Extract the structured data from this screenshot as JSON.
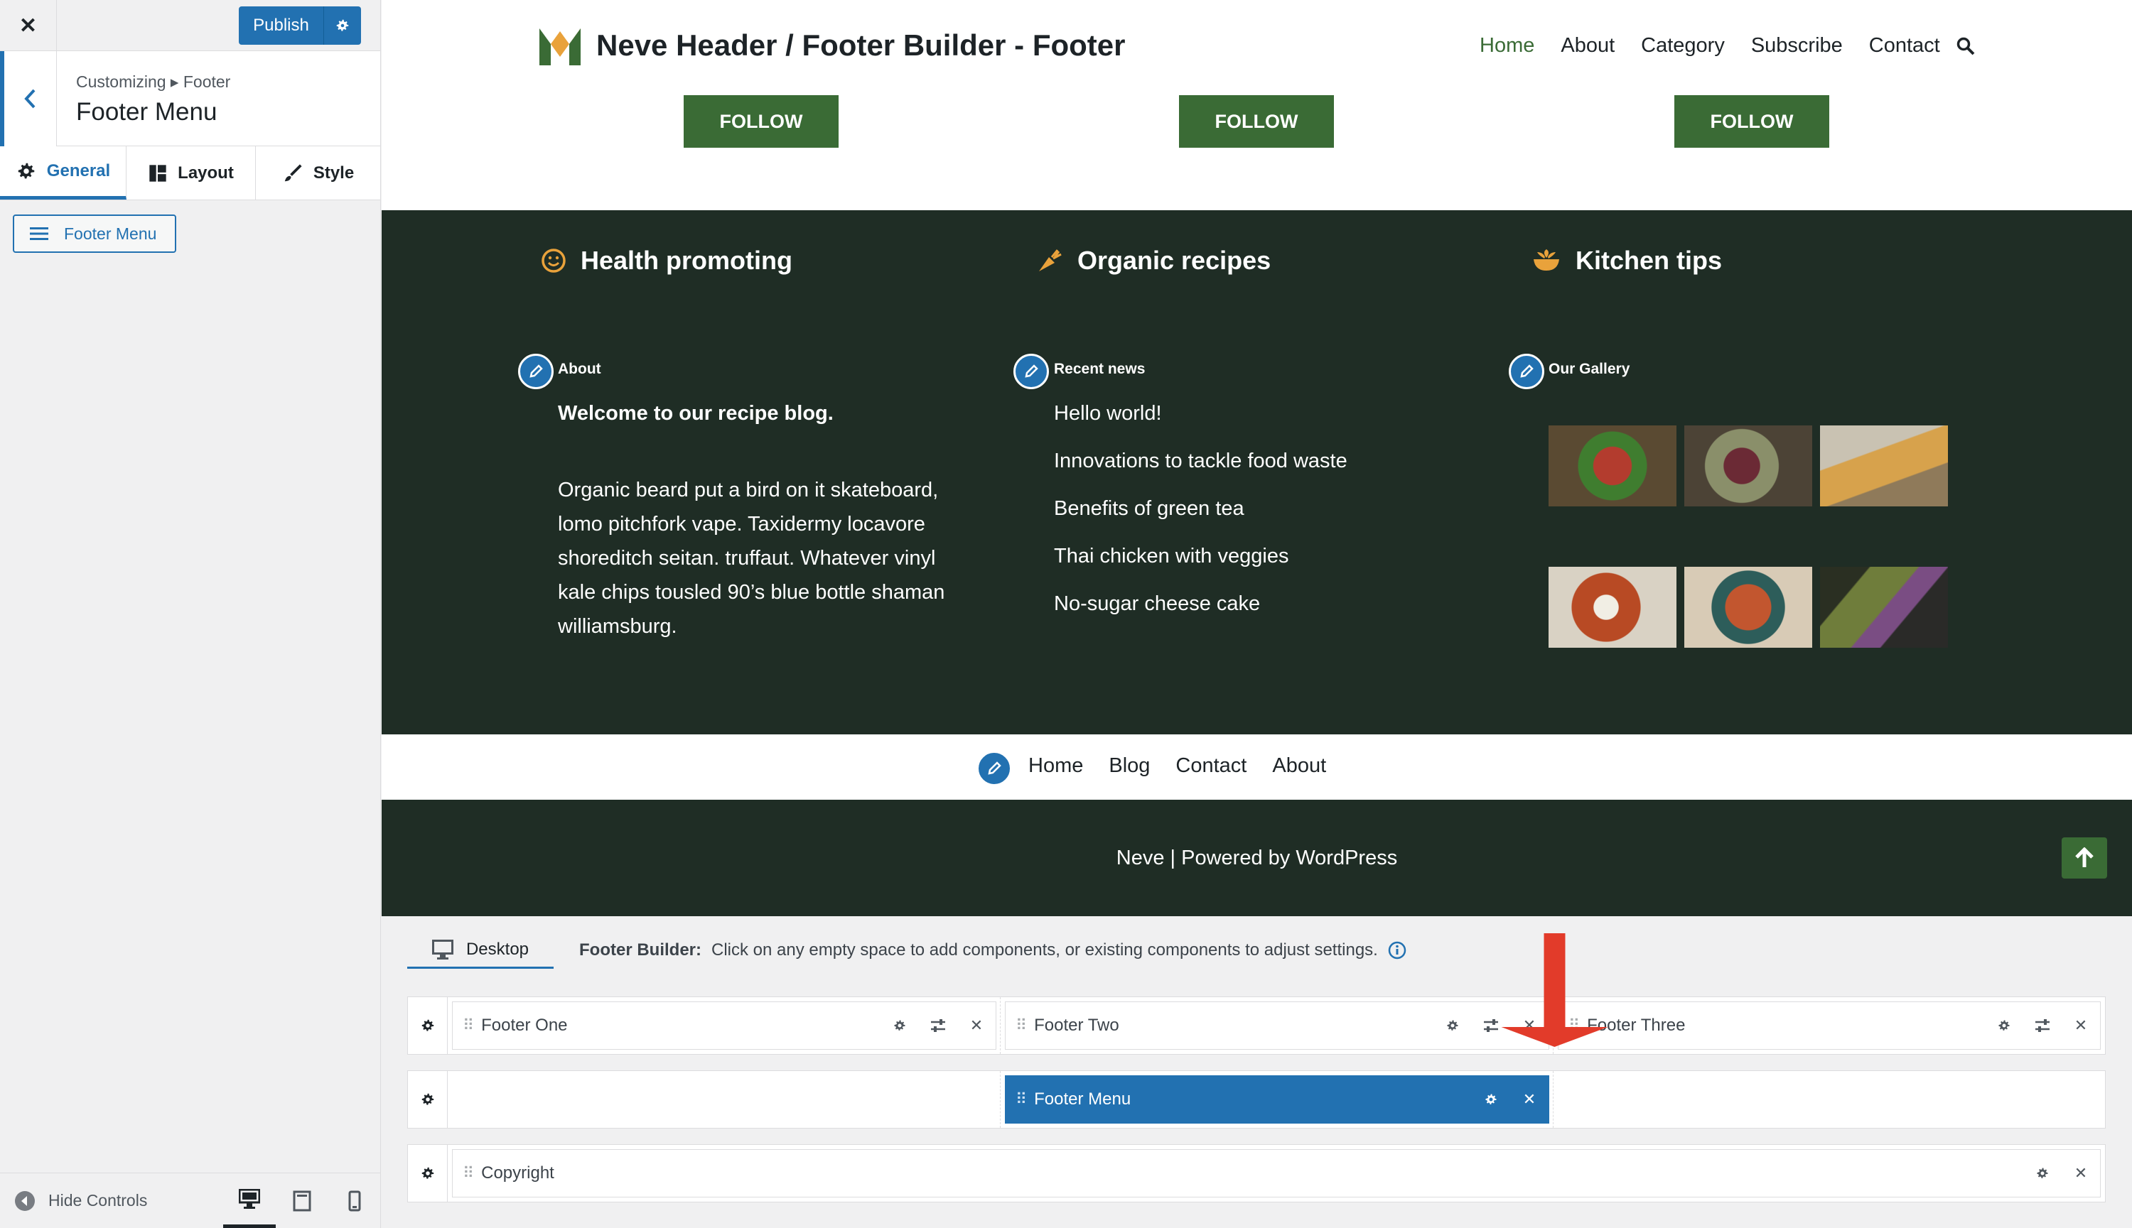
{
  "customizer": {
    "close_glyph": "✕",
    "publish_label": "Publish",
    "breadcrumb": "Customizing ▸ Footer",
    "section_title": "Footer Menu",
    "tabs": [
      {
        "label": "General",
        "icon": "gear-icon",
        "active": true
      },
      {
        "label": "Layout",
        "icon": "layout-icon",
        "active": false
      },
      {
        "label": "Style",
        "icon": "brush-icon",
        "active": false
      }
    ],
    "component_chip": "Footer Menu",
    "hide_controls": "Hide Controls",
    "devices": [
      "desktop-icon",
      "tablet-icon",
      "mobile-icon"
    ]
  },
  "site": {
    "title": "Neve Header / Footer Builder - Footer",
    "nav": [
      "Home",
      "About",
      "Category",
      "Subscribe",
      "Contact"
    ],
    "follow_label": "FOLLOW",
    "features": [
      {
        "label": "Health promoting",
        "icon": "smile-icon"
      },
      {
        "label": "Organic recipes",
        "icon": "carrot-icon"
      },
      {
        "label": "Kitchen tips",
        "icon": "bowl-icon"
      }
    ],
    "widgets": {
      "about_title": "About",
      "about_strong": "Welcome to our recipe blog.",
      "about_body": "Organic beard put a bird on it skateboard, lomo pitchfork vape. Taxidermy locavore shoreditch seitan. truffaut. Whatever vinyl kale chips tousled 90’s blue bottle shaman williamsburg.",
      "news_title": "Recent news",
      "news": [
        "Hello world!",
        "Innovations to tackle food waste",
        "Benefits of green tea",
        "Thai chicken with veggies",
        "No-sugar cheese cake"
      ],
      "gallery_title": "Our Gallery"
    },
    "footer_menu": [
      "Home",
      "Blog",
      "Contact",
      "About"
    ],
    "copyright": "Neve | Powered by WordPress",
    "colors": {
      "accent_green": "#3a6b35",
      "footer_bg": "#1f2d25",
      "wp_blue": "#2271b1"
    }
  },
  "builder": {
    "device_tab": "Desktop",
    "desc_strong": "Footer Builder:",
    "desc_text": "Click on any empty space to add components, or existing components to adjust settings.",
    "rows": {
      "top": [
        "Footer One",
        "Footer Two",
        "Footer Three"
      ],
      "main": [
        "Footer Menu"
      ],
      "bottom": [
        "Copyright"
      ]
    }
  }
}
